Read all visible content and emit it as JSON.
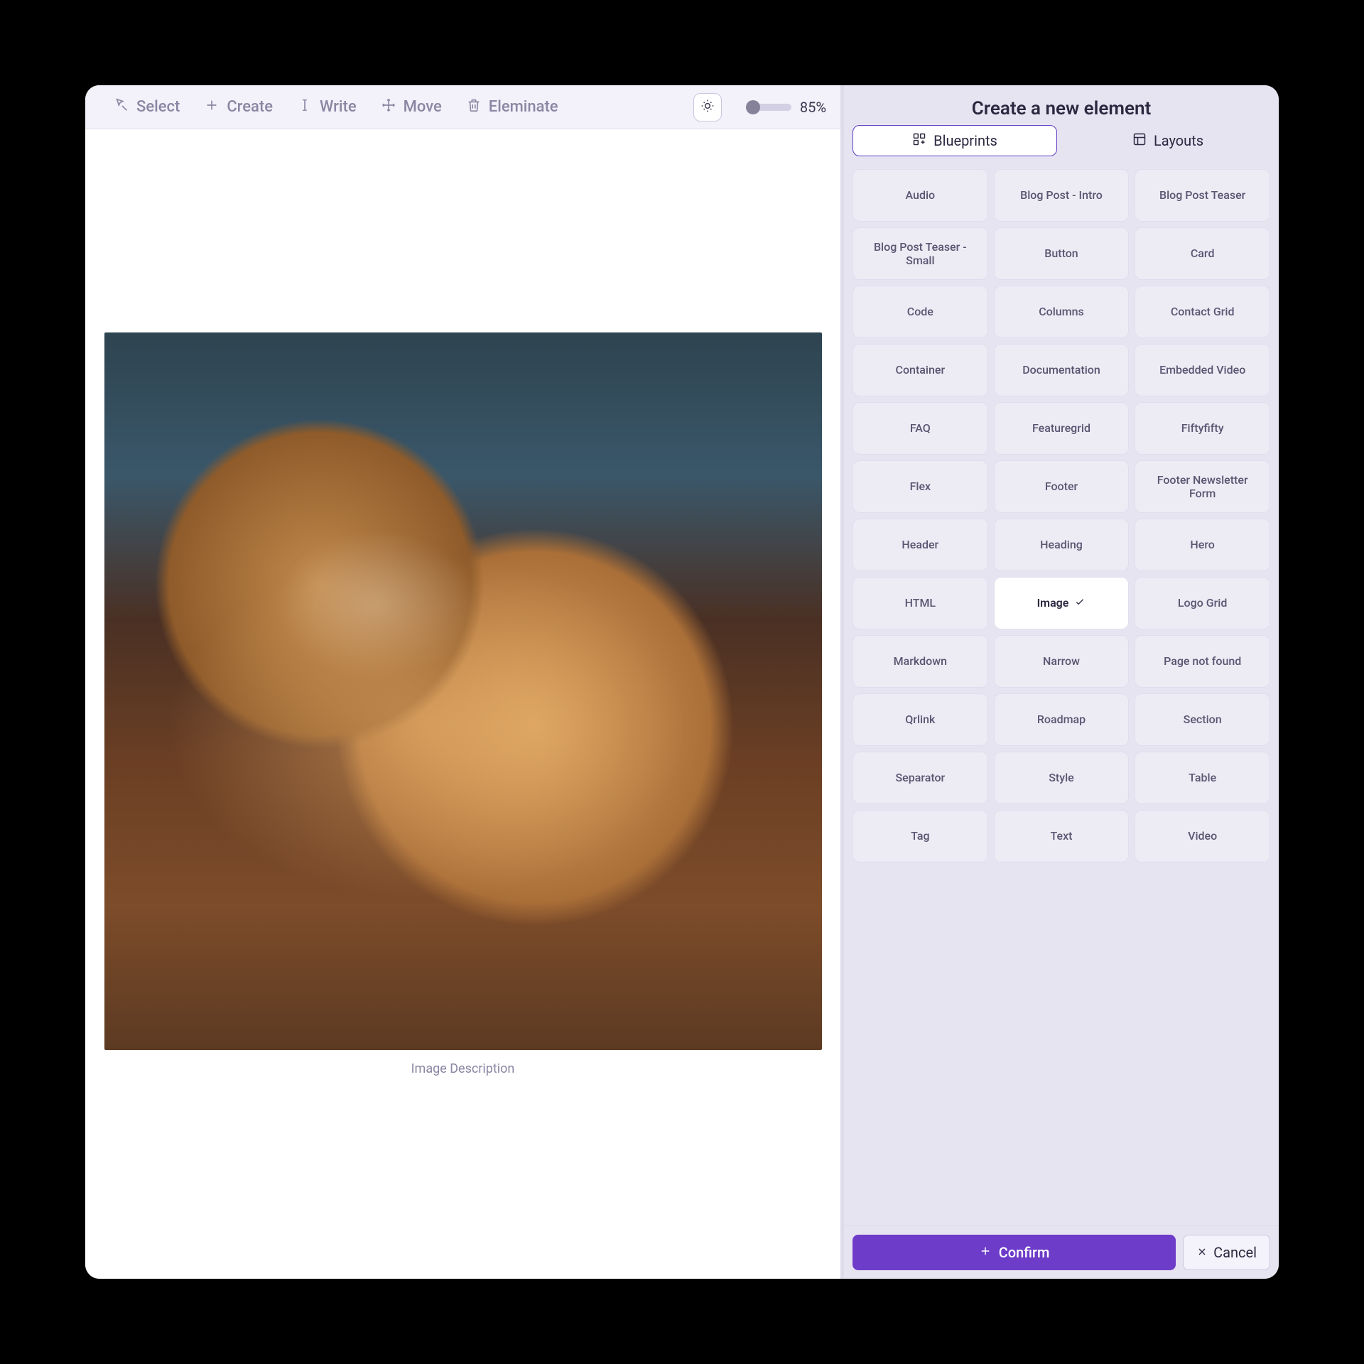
{
  "toolbar": {
    "select": "Select",
    "create": "Create",
    "write": "Write",
    "move": "Move",
    "eliminate": "Eleminate",
    "zoom": "85%"
  },
  "canvas": {
    "caption": "Image Description"
  },
  "panel": {
    "title": "Create a new element",
    "tabs": {
      "blueprints": "Blueprints",
      "layouts": "Layouts"
    },
    "selected": "Image",
    "blueprints": [
      "Audio",
      "Blog Post - Intro",
      "Blog Post Teaser",
      "Blog Post Teaser - Small",
      "Button",
      "Card",
      "Code",
      "Columns",
      "Contact Grid",
      "Container",
      "Documentation",
      "Embedded Video",
      "FAQ",
      "Featuregrid",
      "Fiftyfifty",
      "Flex",
      "Footer",
      "Footer Newsletter Form",
      "Header",
      "Heading",
      "Hero",
      "HTML",
      "Image",
      "Logo Grid",
      "Markdown",
      "Narrow",
      "Page not found",
      "Qrlink",
      "Roadmap",
      "Section",
      "Separator",
      "Style",
      "Table",
      "Tag",
      "Text",
      "Video"
    ],
    "confirm": "Confirm",
    "cancel": "Cancel"
  }
}
